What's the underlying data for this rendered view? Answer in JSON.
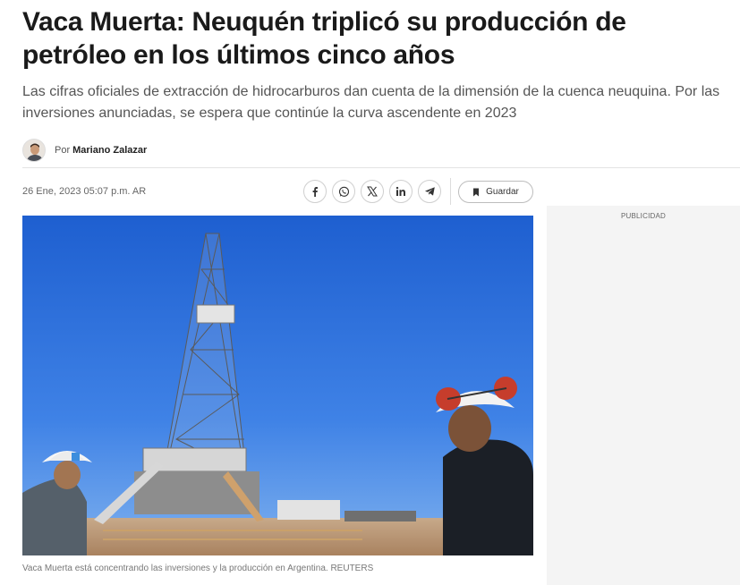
{
  "article": {
    "headline": "Vaca Muerta: Neuquén triplicó su producción de petróleo en los últimos cinco años",
    "subhead": "Las cifras oficiales de extracción de hidrocarburos dan cuenta de la dimensión de la cuenca neuquina. Por las inversiones anunciadas, se espera que continúe la curva ascendente en 2023",
    "author_prefix": "Por",
    "author_name": "Mariano Zalazar",
    "date": "26 Ene, 2023 05:07 p.m. AR",
    "image_caption": "Vaca Muerta está concentrando las inversiones y la producción en Argentina. REUTERS"
  },
  "share": {
    "icons": [
      "facebook-icon",
      "whatsapp-icon",
      "x-icon",
      "linkedin-icon",
      "telegram-icon"
    ],
    "save_label": "Guardar",
    "save_icon": "bookmark-icon"
  },
  "sidebar": {
    "ad_label": "PUBLICIDAD"
  }
}
